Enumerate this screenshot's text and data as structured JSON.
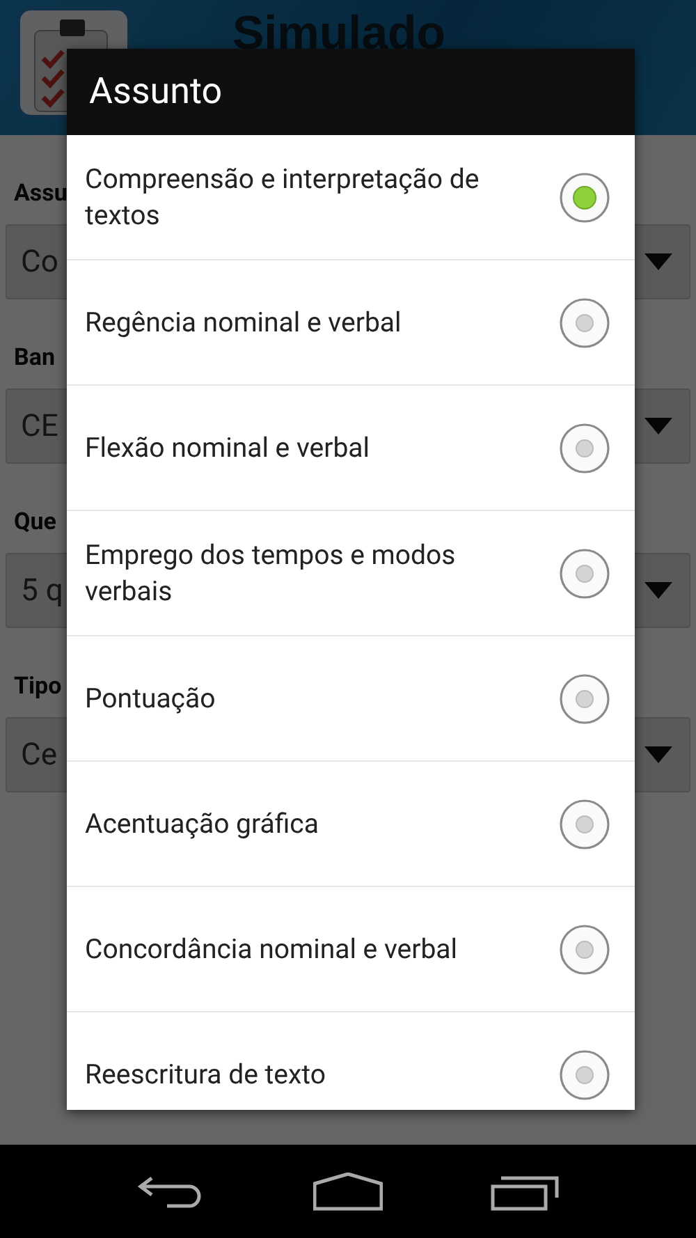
{
  "app_bar": {
    "title": "Simulado"
  },
  "form": [
    {
      "label": "Assu",
      "value": "Co"
    },
    {
      "label": "Ban",
      "value": "CE"
    },
    {
      "label": "Que",
      "value": "5 q"
    },
    {
      "label": "Tipo",
      "value": "Ce"
    }
  ],
  "dialog": {
    "title": "Assunto",
    "options": [
      {
        "label": "Compreensão e interpretação de textos",
        "selected": true
      },
      {
        "label": "Regência nominal e verbal",
        "selected": false
      },
      {
        "label": "Flexão nominal e verbal",
        "selected": false
      },
      {
        "label": "Emprego dos tempos e modos verbais",
        "selected": false
      },
      {
        "label": "Pontuação",
        "selected": false
      },
      {
        "label": "Acentuação gráfica",
        "selected": false
      },
      {
        "label": "Concordância nominal e verbal",
        "selected": false
      },
      {
        "label": "Reescritura de texto",
        "selected": false
      }
    ]
  }
}
